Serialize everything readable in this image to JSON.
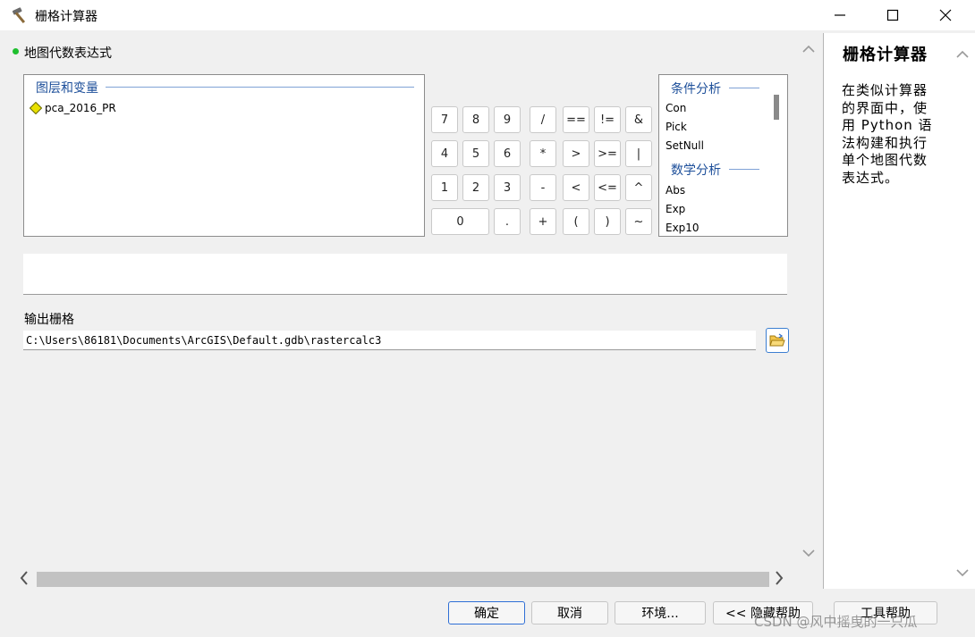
{
  "window": {
    "title": "栅格计算器",
    "min_icon": "minimize-icon",
    "max_icon": "maximize-icon",
    "close_icon": "close-icon"
  },
  "expression": {
    "label": "地图代数表达式",
    "text": ""
  },
  "layers_panel": {
    "header": "图层和变量",
    "items": [
      "pca_2016_PR"
    ]
  },
  "calculator": {
    "keys": [
      "7",
      "8",
      "9",
      "/",
      "==",
      "!=",
      "&",
      "4",
      "5",
      "6",
      "*",
      ">",
      ">=",
      "|",
      "1",
      "2",
      "3",
      "-",
      "<",
      "<=",
      "^",
      "0",
      ".",
      "+",
      "(",
      ")",
      "~"
    ]
  },
  "functions_panel": {
    "groups": [
      {
        "header": "条件分析",
        "items": [
          "Con",
          "Pick",
          "SetNull"
        ]
      },
      {
        "header": "数学分析",
        "items": [
          "Abs",
          "Exp",
          "Exp10"
        ]
      }
    ]
  },
  "output": {
    "label": "输出栅格",
    "value": "C:\\Users\\86181\\Documents\\ArcGIS\\Default.gdb\\rastercalc3"
  },
  "help": {
    "title": "栅格计算器",
    "body": "在类似计算器的界面中，使用 Python 语法构建和执行单个地图代数表达式。"
  },
  "buttons": {
    "ok": "确定",
    "cancel": "取消",
    "env": "环境...",
    "hide_help": "<< 隐藏帮助",
    "tool_help": "工具帮助"
  },
  "watermark": "CSDN @风中摇曳的一只瓜",
  "colors": {
    "accent_blue": "#1d4f9a",
    "status_green": "#1fbf2f",
    "layer_yellow": "#e8e000"
  }
}
